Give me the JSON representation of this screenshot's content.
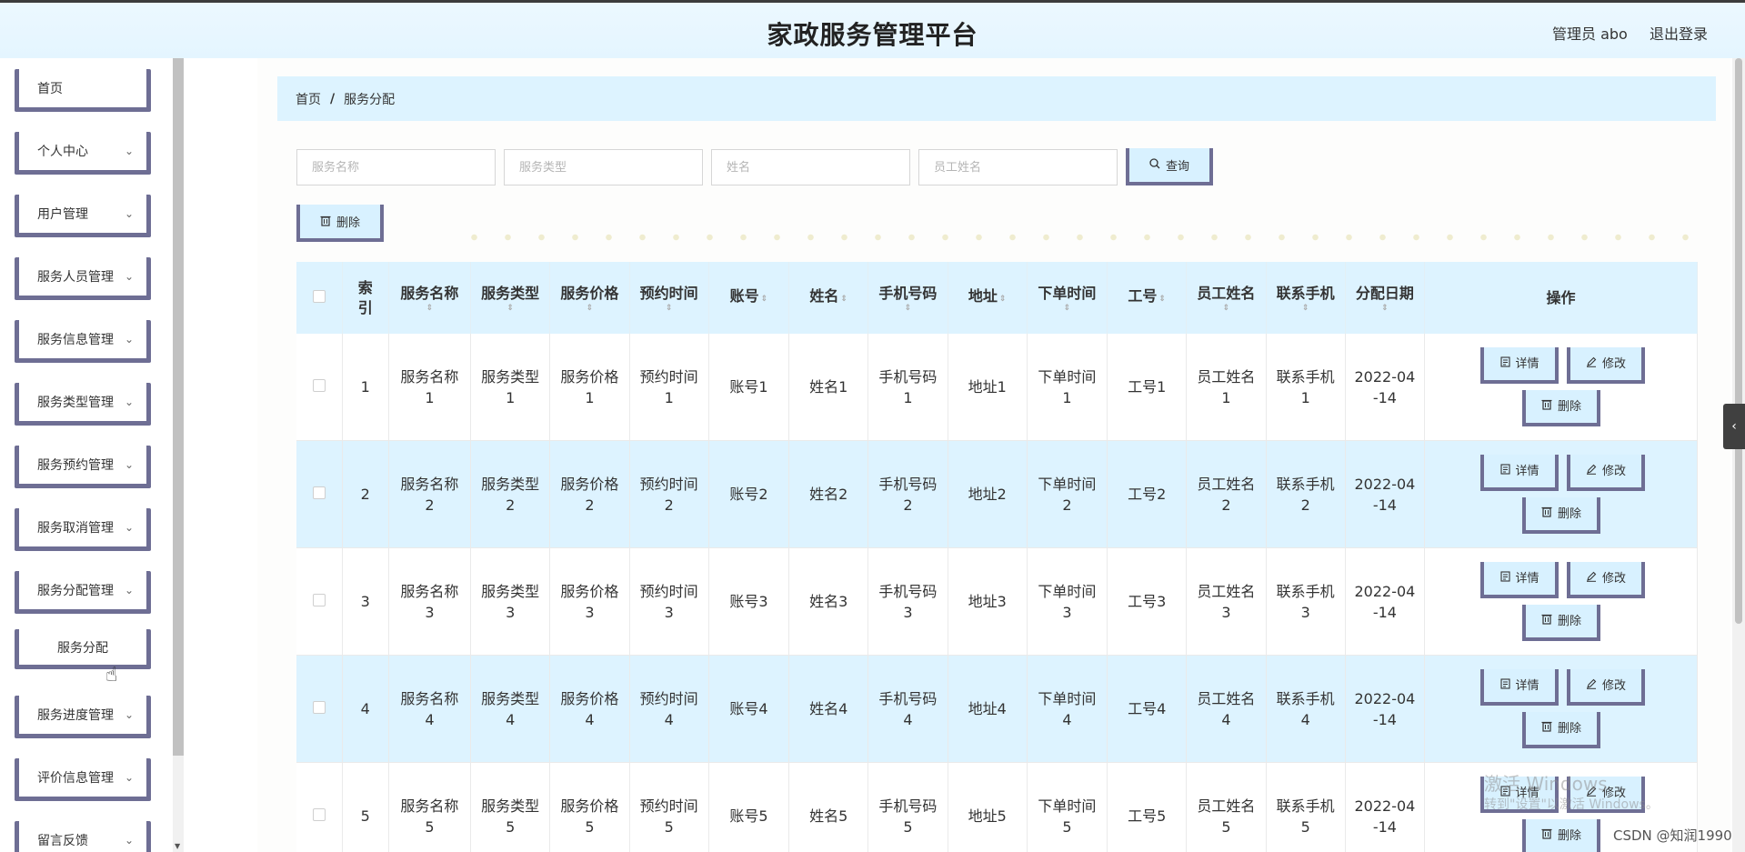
{
  "header": {
    "title": "家政服务管理平台",
    "user": "管理员 abo",
    "logout": "退出登录"
  },
  "sidebar": {
    "items": [
      {
        "label": "首页"
      },
      {
        "label": "个人中心"
      },
      {
        "label": "用户管理"
      },
      {
        "label": "服务人员管理"
      },
      {
        "label": "服务信息管理"
      },
      {
        "label": "服务类型管理"
      },
      {
        "label": "服务预约管理"
      },
      {
        "label": "服务取消管理"
      },
      {
        "label": "服务分配管理"
      },
      {
        "label": "服务分配"
      },
      {
        "label": "服务进度管理"
      },
      {
        "label": "评价信息管理"
      },
      {
        "label": "留言反馈"
      }
    ],
    "chevron": "⌄"
  },
  "breadcrumb": {
    "home": "首页",
    "separator": "/",
    "current": "服务分配"
  },
  "search": {
    "service_name_placeholder": "服务名称",
    "service_type_placeholder": "服务类型",
    "name_placeholder": "姓名",
    "employee_name_placeholder": "员工姓名",
    "query_label": "查询"
  },
  "toolbar": {
    "delete_label": "删除"
  },
  "table": {
    "headers": {
      "index": "索引",
      "service_name": "服务名称",
      "service_type": "服务类型",
      "service_price": "服务价格",
      "booking_time": "预约时间",
      "account": "账号",
      "name": "姓名",
      "phone": "手机号码",
      "address": "地址",
      "order_time": "下单时间",
      "employee_no": "工号",
      "employee_name": "员工姓名",
      "contact_phone": "联系手机",
      "assign_date": "分配日期",
      "actions": "操作"
    },
    "sort_glyph": "⇕",
    "actions": {
      "detail": "详情",
      "edit": "修改",
      "delete": "删除"
    },
    "rows": [
      {
        "index": "1",
        "service_name": "服务名称\n1",
        "service_type": "服务类型\n1",
        "service_price": "服务价格\n1",
        "booking_time": "预约时间\n1",
        "account": "账号1",
        "name": "姓名1",
        "phone": "手机号码\n1",
        "address": "地址1",
        "order_time": "下单时间\n1",
        "employee_no": "工号1",
        "employee_name": "员工姓名\n1",
        "contact_phone": "联系手机\n1",
        "assign_date": "2022-04\n-14"
      },
      {
        "index": "2",
        "service_name": "服务名称\n2",
        "service_type": "服务类型\n2",
        "service_price": "服务价格\n2",
        "booking_time": "预约时间\n2",
        "account": "账号2",
        "name": "姓名2",
        "phone": "手机号码\n2",
        "address": "地址2",
        "order_time": "下单时间\n2",
        "employee_no": "工号2",
        "employee_name": "员工姓名\n2",
        "contact_phone": "联系手机\n2",
        "assign_date": "2022-04\n-14"
      },
      {
        "index": "3",
        "service_name": "服务名称\n3",
        "service_type": "服务类型\n3",
        "service_price": "服务价格\n3",
        "booking_time": "预约时间\n3",
        "account": "账号3",
        "name": "姓名3",
        "phone": "手机号码\n3",
        "address": "地址3",
        "order_time": "下单时间\n3",
        "employee_no": "工号3",
        "employee_name": "员工姓名\n3",
        "contact_phone": "联系手机\n3",
        "assign_date": "2022-04\n-14"
      },
      {
        "index": "4",
        "service_name": "服务名称\n4",
        "service_type": "服务类型\n4",
        "service_price": "服务价格\n4",
        "booking_time": "预约时间\n4",
        "account": "账号4",
        "name": "姓名4",
        "phone": "手机号码\n4",
        "address": "地址4",
        "order_time": "下单时间\n4",
        "employee_no": "工号4",
        "employee_name": "员工姓名\n4",
        "contact_phone": "联系手机\n4",
        "assign_date": "2022-04\n-14"
      },
      {
        "index": "5",
        "service_name": "服务名称\n5",
        "service_type": "服务类型\n5",
        "service_price": "服务价格\n5",
        "booking_time": "预约时间\n5",
        "account": "账号5",
        "name": "姓名5",
        "phone": "手机号码\n5",
        "address": "地址5",
        "order_time": "下单时间\n5",
        "employee_no": "工号5",
        "employee_name": "员工姓名\n5",
        "contact_phone": "联系手机\n5",
        "assign_date": "2022-04\n-14"
      }
    ]
  },
  "overlay": {
    "watermark_line1": "激活 Windows",
    "watermark_line2": "转到\"设置\"以激活 Windows。",
    "csdn": "CSDN @知润1990"
  },
  "icons": {
    "search": "search-icon",
    "delete": "trash-icon",
    "detail": "document-icon",
    "edit": "pencil-icon",
    "toggle": "chevron-left-icon"
  },
  "colors": {
    "header_bg": "#e4f5ff",
    "accent_light": "#ddf3ff",
    "button_bg": "#d8f1ff",
    "button_border": "#6e6e94"
  }
}
